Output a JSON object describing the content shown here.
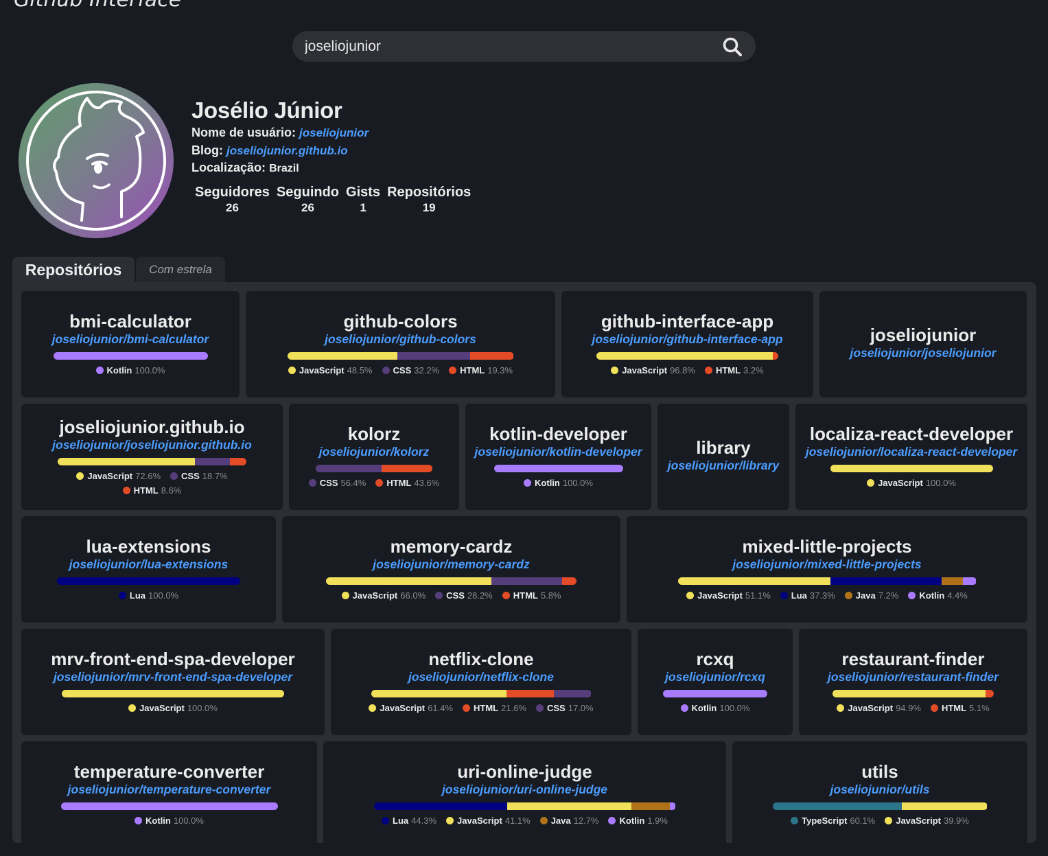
{
  "app": {
    "title": "Github Interface"
  },
  "search": {
    "value": "joseliojunior"
  },
  "profile": {
    "name": "Josélio Júnior",
    "username_label": "Nome de usuário:",
    "username": "joseliojunior",
    "blog_label": "Blog:",
    "blog": "joseliojunior.github.io",
    "location_label": "Localização:",
    "location": "Brazil",
    "stats": [
      {
        "label": "Seguidores",
        "value": "26"
      },
      {
        "label": "Seguindo",
        "value": "26"
      },
      {
        "label": "Gists",
        "value": "1"
      },
      {
        "label": "Repositórios",
        "value": "19"
      }
    ]
  },
  "tabs": [
    {
      "label": "Repositórios",
      "active": true
    },
    {
      "label": "Com estrela",
      "active": false
    }
  ],
  "colors": {
    "JavaScript": "#f0e05a",
    "CSS": "#563d7c",
    "HTML": "#e34c26",
    "Kotlin": "#a97bff",
    "Lua": "#000080",
    "Java": "#b07219",
    "TypeScript": "#2b7489",
    "link": "#4c9dff"
  },
  "repos": [
    {
      "name": "bmi-calculator",
      "path": "joseliojunior/bmi-calculator",
      "languages": [
        {
          "name": "Kotlin",
          "pct": 100.0,
          "label": "100.0%"
        }
      ]
    },
    {
      "name": "github-colors",
      "path": "joseliojunior/github-colors",
      "languages": [
        {
          "name": "JavaScript",
          "pct": 48.5,
          "label": "48.5%"
        },
        {
          "name": "CSS",
          "pct": 32.2,
          "label": "32.2%"
        },
        {
          "name": "HTML",
          "pct": 19.3,
          "label": "19.3%"
        }
      ]
    },
    {
      "name": "github-interface-app",
      "path": "joseliojunior/github-interface-app",
      "languages": [
        {
          "name": "JavaScript",
          "pct": 96.8,
          "label": "96.8%"
        },
        {
          "name": "HTML",
          "pct": 3.2,
          "label": "3.2%"
        }
      ]
    },
    {
      "name": "joseliojunior",
      "path": "joseliojunior/joseliojunior",
      "languages": []
    },
    {
      "name": "joseliojunior.github.io",
      "path": "joseliojunior/joseliojunior.github.io",
      "languages": [
        {
          "name": "JavaScript",
          "pct": 72.6,
          "label": "72.6%"
        },
        {
          "name": "CSS",
          "pct": 18.7,
          "label": "18.7%"
        },
        {
          "name": "HTML",
          "pct": 8.6,
          "label": "8.6%"
        }
      ]
    },
    {
      "name": "kolorz",
      "path": "joseliojunior/kolorz",
      "languages": [
        {
          "name": "CSS",
          "pct": 56.4,
          "label": "56.4%"
        },
        {
          "name": "HTML",
          "pct": 43.6,
          "label": "43.6%"
        }
      ]
    },
    {
      "name": "kotlin-developer",
      "path": "joseliojunior/kotlin-developer",
      "languages": [
        {
          "name": "Kotlin",
          "pct": 100.0,
          "label": "100.0%"
        }
      ]
    },
    {
      "name": "library",
      "path": "joseliojunior/library",
      "languages": []
    },
    {
      "name": "localiza-react-developer",
      "path": "joseliojunior/localiza-react-developer",
      "languages": [
        {
          "name": "JavaScript",
          "pct": 100.0,
          "label": "100.0%"
        }
      ]
    },
    {
      "name": "lua-extensions",
      "path": "joseliojunior/lua-extensions",
      "languages": [
        {
          "name": "Lua",
          "pct": 100.0,
          "label": "100.0%"
        }
      ]
    },
    {
      "name": "memory-cardz",
      "path": "joseliojunior/memory-cardz",
      "languages": [
        {
          "name": "JavaScript",
          "pct": 66.0,
          "label": "66.0%"
        },
        {
          "name": "CSS",
          "pct": 28.2,
          "label": "28.2%"
        },
        {
          "name": "HTML",
          "pct": 5.8,
          "label": "5.8%"
        }
      ]
    },
    {
      "name": "mixed-little-projects",
      "path": "joseliojunior/mixed-little-projects",
      "languages": [
        {
          "name": "JavaScript",
          "pct": 51.1,
          "label": "51.1%"
        },
        {
          "name": "Lua",
          "pct": 37.3,
          "label": "37.3%"
        },
        {
          "name": "Java",
          "pct": 7.2,
          "label": "7.2%"
        },
        {
          "name": "Kotlin",
          "pct": 4.4,
          "label": "4.4%"
        }
      ]
    },
    {
      "name": "mrv-front-end-spa-developer",
      "path": "joseliojunior/mrv-front-end-spa-developer",
      "languages": [
        {
          "name": "JavaScript",
          "pct": 100.0,
          "label": "100.0%"
        }
      ]
    },
    {
      "name": "netflix-clone",
      "path": "joseliojunior/netflix-clone",
      "languages": [
        {
          "name": "JavaScript",
          "pct": 61.4,
          "label": "61.4%"
        },
        {
          "name": "HTML",
          "pct": 21.6,
          "label": "21.6%"
        },
        {
          "name": "CSS",
          "pct": 17.0,
          "label": "17.0%"
        }
      ]
    },
    {
      "name": "rcxq",
      "path": "joseliojunior/rcxq",
      "languages": [
        {
          "name": "Kotlin",
          "pct": 100.0,
          "label": "100.0%"
        }
      ]
    },
    {
      "name": "restaurant-finder",
      "path": "joseliojunior/restaurant-finder",
      "languages": [
        {
          "name": "JavaScript",
          "pct": 94.9,
          "label": "94.9%"
        },
        {
          "name": "HTML",
          "pct": 5.1,
          "label": "5.1%"
        }
      ]
    },
    {
      "name": "temperature-converter",
      "path": "joseliojunior/temperature-converter",
      "languages": [
        {
          "name": "Kotlin",
          "pct": 100.0,
          "label": "100.0%"
        }
      ]
    },
    {
      "name": "uri-online-judge",
      "path": "joseliojunior/uri-online-judge",
      "languages": [
        {
          "name": "Lua",
          "pct": 44.3,
          "label": "44.3%"
        },
        {
          "name": "JavaScript",
          "pct": 41.1,
          "label": "41.1%"
        },
        {
          "name": "Java",
          "pct": 12.7,
          "label": "12.7%"
        },
        {
          "name": "Kotlin",
          "pct": 1.9,
          "label": "1.9%"
        }
      ]
    },
    {
      "name": "utils",
      "path": "joseliojunior/utils",
      "languages": [
        {
          "name": "TypeScript",
          "pct": 60.1,
          "label": "60.1%"
        },
        {
          "name": "JavaScript",
          "pct": 39.9,
          "label": "39.9%"
        }
      ]
    }
  ]
}
